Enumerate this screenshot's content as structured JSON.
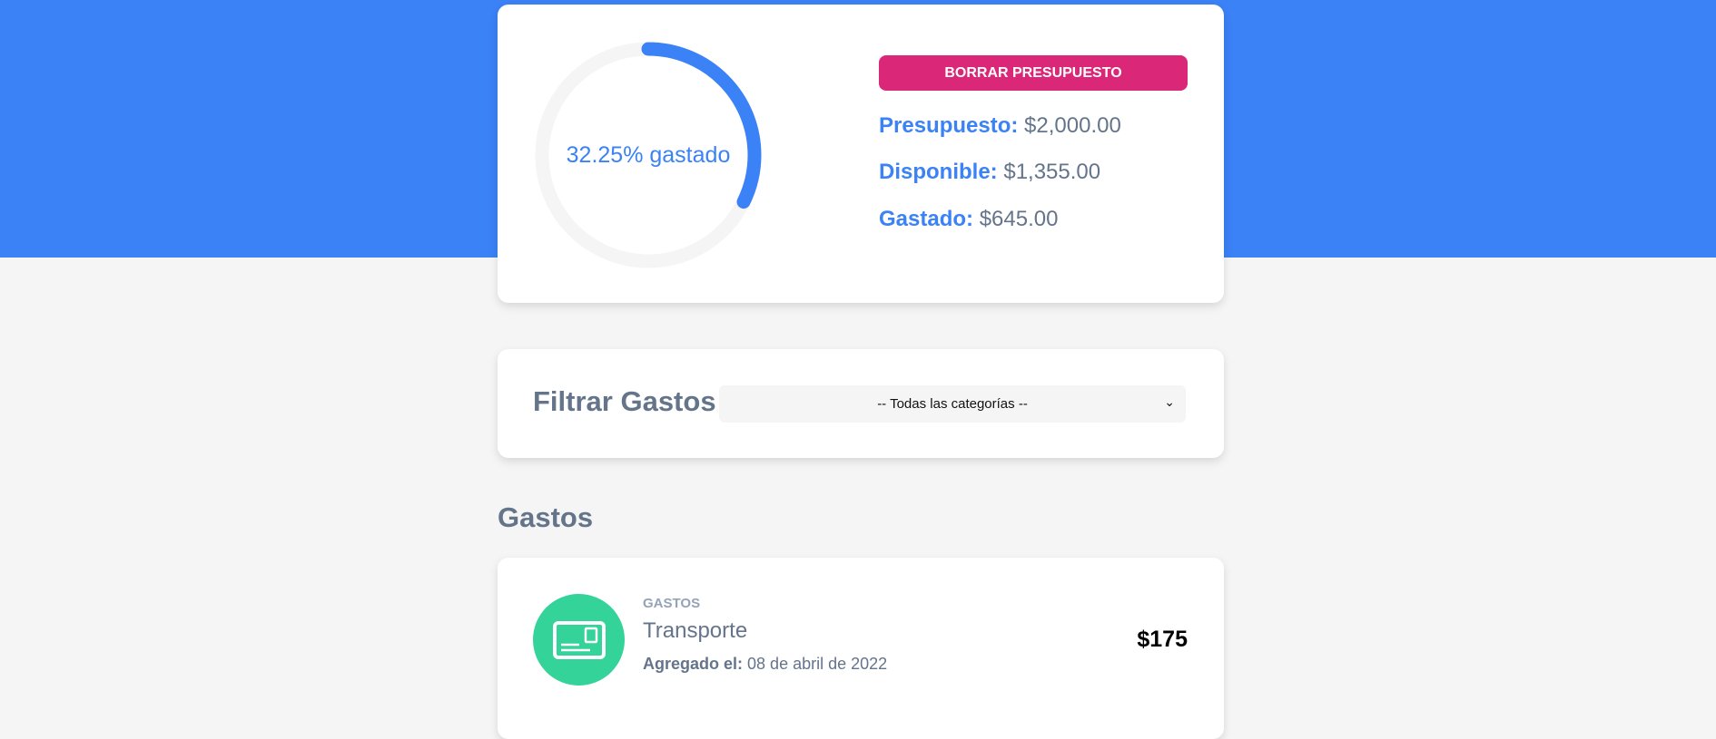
{
  "budget": {
    "progress_percent": 32.25,
    "progress_text": "32.25% gastado",
    "reset_label": "BORRAR PRESUPUESTO",
    "budget_label": "Presupuesto:",
    "budget_value": "$2,000.00",
    "available_label": "Disponible:",
    "available_value": "$1,355.00",
    "spent_label": "Gastado:",
    "spent_value": "$645.00",
    "colors": {
      "progress": "#3b82f6",
      "track": "#f5f5f5",
      "accent": "#db2777"
    }
  },
  "filter": {
    "title": "Filtrar Gastos",
    "selected": "-- Todas las categorías --"
  },
  "expenses": {
    "title": "Gastos",
    "items": [
      {
        "category": "GASTOS",
        "name": "Transporte",
        "date_label": "Agregado el:",
        "date_value": "08 de abril de 2022",
        "amount": "$175",
        "icon": "card-icon",
        "icon_color": "#34d399"
      }
    ]
  }
}
